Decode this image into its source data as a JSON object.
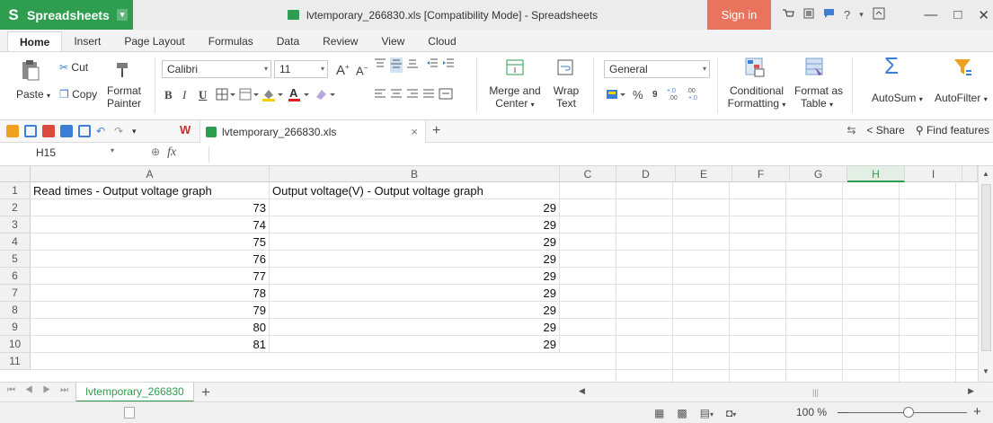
{
  "app": {
    "name": "Spreadsheets",
    "logo_icon": "S",
    "caret": "▾"
  },
  "window": {
    "title": "lvtemporary_266830.xls [Compatibility Mode] - Spreadsheets",
    "sign_in": "Sign in",
    "minimize": "—",
    "maximize": "□",
    "close": "✕",
    "help": "?",
    "help_caret": "▾"
  },
  "menu": {
    "tabs": [
      "Home",
      "Insert",
      "Page Layout",
      "Formulas",
      "Data",
      "Review",
      "View",
      "Cloud"
    ],
    "active": "Home"
  },
  "ribbon": {
    "paste": "Paste",
    "dd": "▾",
    "cut": "Cut",
    "copy": "Copy",
    "format_painter_1": "Format",
    "format_painter_2": "Painter",
    "font_name": "Calibri",
    "font_size": "11",
    "bold": "B",
    "italic": "I",
    "underline": "U",
    "grow_font": "A",
    "shrink_font": "A",
    "merge_1": "Merge and",
    "merge_2": "Center",
    "wrap_1": "Wrap",
    "wrap_2": "Text",
    "number_format": "General",
    "percent": "%",
    "comma": "9",
    "cond_1": "Conditional",
    "cond_2": "Formatting",
    "fmt_table_1": "Format as",
    "fmt_table_2": "Table",
    "autosum": "AutoSum",
    "autofilter": "AutoFilter",
    "sigma": "Σ"
  },
  "quickbar": {
    "file_tab": "lvtemporary_266830.xls",
    "close_tab": "×",
    "new_tab": "+",
    "share": "Share",
    "find": "Find features",
    "wps": "W",
    "dropdown": "▾"
  },
  "formula_bar": {
    "name_box": "H15",
    "dd": "▾",
    "fx": "fx",
    "zoom_icon": "🔍",
    "content": ""
  },
  "sheet": {
    "columns": [
      "A",
      "B",
      "C",
      "D",
      "E",
      "F",
      "G",
      "H",
      "I"
    ],
    "selected_column": "H",
    "row_numbers": [
      "1",
      "2",
      "3",
      "4",
      "5",
      "6",
      "7",
      "8",
      "9",
      "10",
      "11"
    ],
    "header_row": [
      "Read times - Output voltage graph",
      "Output voltage(V) - Output voltage graph"
    ],
    "rows": [
      [
        "73",
        "29"
      ],
      [
        "74",
        "29"
      ],
      [
        "75",
        "29"
      ],
      [
        "76",
        "29"
      ],
      [
        "77",
        "29"
      ],
      [
        "78",
        "29"
      ],
      [
        "79",
        "29"
      ],
      [
        "80",
        "29"
      ],
      [
        "81",
        "29"
      ]
    ]
  },
  "sheet_tabs": {
    "active": "lvtemporary_266830",
    "add": "+",
    "nav": "⏮ ◀ ▶ ⏭"
  },
  "status": {
    "zoom": "100 %",
    "zoom_minus": "—",
    "zoom_plus": "+",
    "zoom_caret": "▾"
  },
  "colors": {
    "accent": "#2e9d4f",
    "signin": "#e8745e"
  }
}
